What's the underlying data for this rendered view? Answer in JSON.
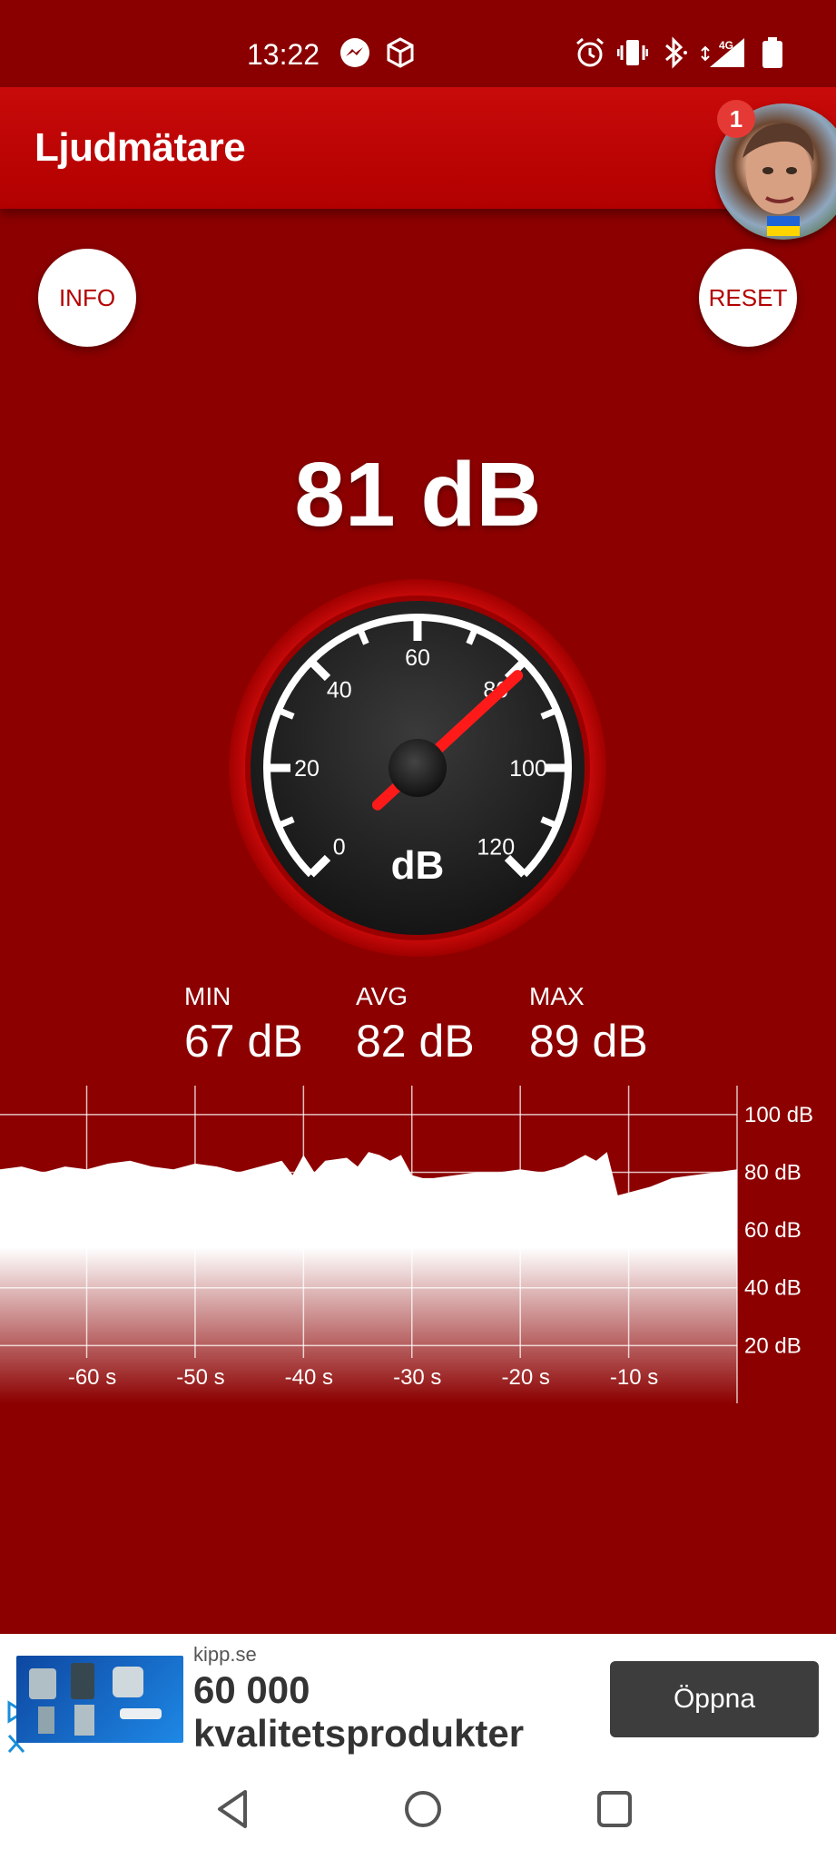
{
  "status_bar": {
    "time": "13:22",
    "network": "4G"
  },
  "app_bar": {
    "title": "Ljudmätare",
    "notification_count": "1"
  },
  "buttons": {
    "info": "INFO",
    "reset": "RESET"
  },
  "reading": "81 dB",
  "gauge": {
    "tick_labels": [
      "0",
      "20",
      "40",
      "60",
      "80",
      "100",
      "120"
    ],
    "unit": "dB",
    "value": 81,
    "min": 0,
    "max": 120
  },
  "stats": {
    "min_label": "MIN",
    "min_value": "67 dB",
    "avg_label": "AVG",
    "avg_value": "82 dB",
    "max_label": "MAX",
    "max_value": "89 dB"
  },
  "chart_data": {
    "type": "area",
    "x_tick_labels": [
      "-60 s",
      "-50 s",
      "-40 s",
      "-30 s",
      "-20 s",
      "-10 s"
    ],
    "y_tick_labels": [
      "100 dB",
      "80 dB",
      "60 dB",
      "40 dB",
      "20 dB"
    ],
    "ylim": [
      0,
      110
    ],
    "xlim": [
      -68,
      0
    ],
    "grid": true,
    "series": [
      {
        "x": [
          -68,
          -66,
          -64,
          -62,
          -60,
          -58,
          -56,
          -54,
          -52,
          -50,
          -48,
          -46,
          -44,
          -42,
          -41,
          -40,
          -39,
          -38,
          -36,
          -35,
          -34,
          -33,
          -32,
          -31,
          -30,
          -29,
          -28,
          -26,
          -24,
          -22,
          -20,
          -18,
          -16,
          -15,
          -14,
          -13,
          -12,
          -11,
          -10,
          -8,
          -6,
          -4,
          -2,
          0
        ],
        "y": [
          81,
          82,
          80,
          82,
          81,
          83,
          84,
          82,
          81,
          83,
          82,
          80,
          82,
          84,
          79,
          86,
          80,
          84,
          85,
          82,
          87,
          86,
          84,
          86,
          79,
          78,
          78,
          79,
          80,
          80,
          81,
          80,
          82,
          84,
          86,
          84,
          87,
          72,
          73,
          75,
          78,
          79,
          80,
          81
        ]
      }
    ]
  },
  "ad": {
    "domain": "kipp.se",
    "headline_line1": "60 000",
    "headline_line2": "kvalitetsprodukter",
    "cta": "Öppna"
  },
  "nav": {
    "back_icon": "back-triangle-icon",
    "home_icon": "home-circle-icon",
    "recents_icon": "recents-square-icon"
  }
}
